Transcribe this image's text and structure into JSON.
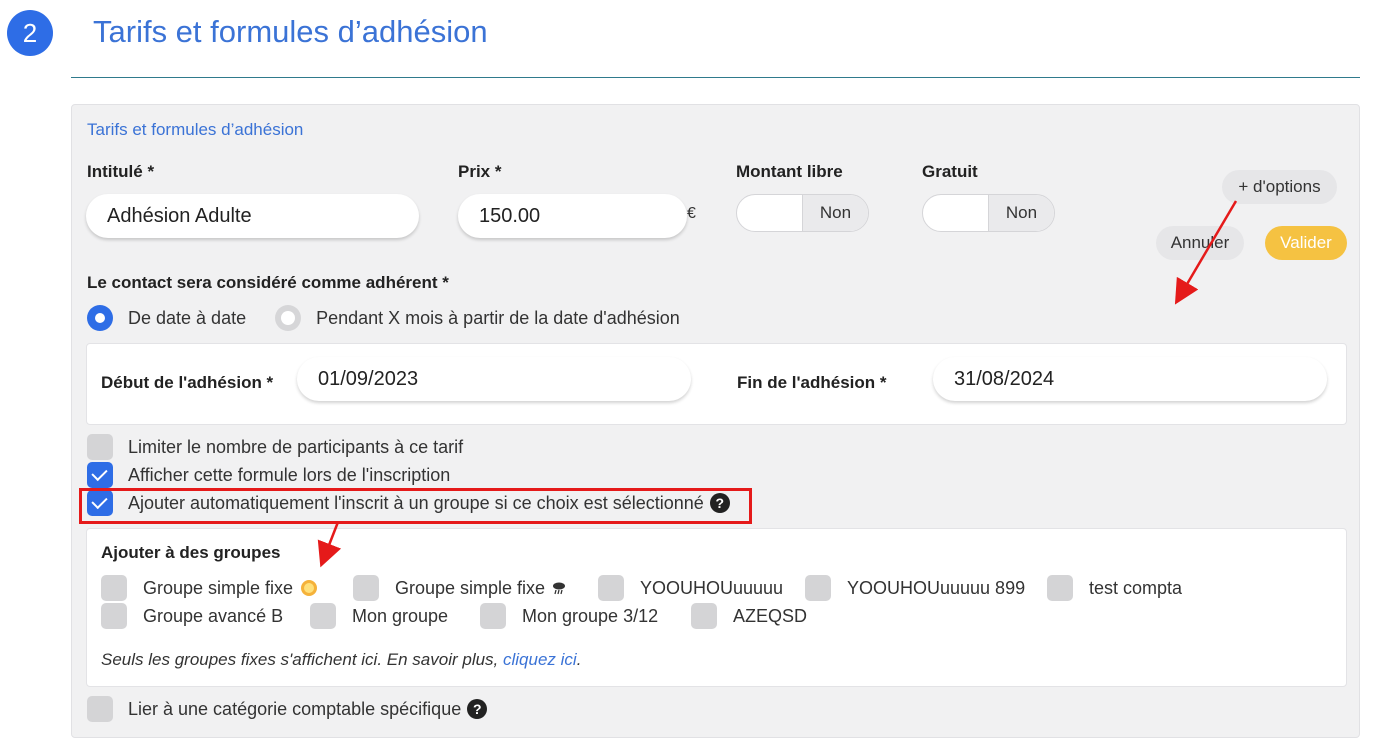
{
  "header": {
    "step_number": "2",
    "title": "Tarifs et formules d’adhésion"
  },
  "panel": {
    "title": "Tarifs et formules d’adhésion",
    "fields": {
      "intitule_label": "Intitulé *",
      "intitule_value": "Adhésion Adulte",
      "prix_label": "Prix *",
      "prix_value": "150.00",
      "currency": "€",
      "montant_libre_label": "Montant libre",
      "montant_libre_state": "Non",
      "gratuit_label": "Gratuit",
      "gratuit_state": "Non"
    },
    "buttons": {
      "options": "+ d'options",
      "cancel": "Annuler",
      "validate": "Valider"
    },
    "adherent": {
      "label": "Le contact sera considéré comme adhérent *",
      "option_dates": "De date à date",
      "option_months": "Pendant X mois à partir de la date d'adhésion"
    },
    "dates": {
      "start_label": "Début de l'adhésion *",
      "start_value": "01/09/2023",
      "end_label": "Fin de l'adhésion *",
      "end_value": "31/08/2024"
    },
    "checks": {
      "limit": "Limiter le nombre de participants à ce tarif",
      "show": "Afficher cette formule lors de l'inscription",
      "auto_group": "Ajouter automatiquement l'inscrit à un groupe si ce choix est sélectionné",
      "accounting": "Lier à une catégorie comptable spécifique"
    },
    "groups": {
      "title": "Ajouter à des groupes",
      "row1": [
        "Groupe simple fixe",
        "Groupe simple fixe",
        "YOOUHOUuuuuu",
        "YOOUHOUuuuuu 899",
        "test compta"
      ],
      "row2": [
        "Groupe avancé B",
        "Mon groupe",
        "Mon groupe 3/12",
        "AZEQSD"
      ],
      "note_text": "Seuls les groupes fixes s'affichent ici. En savoir plus, ",
      "note_link": "cliquez ici",
      "note_end": "."
    }
  },
  "icons": {
    "help": "?",
    "sun": "sun-icon",
    "cloud": "rain-cloud-icon"
  },
  "colors": {
    "accent": "#2e6de6",
    "validate": "#f5c242",
    "highlight": "#e51a1a"
  }
}
